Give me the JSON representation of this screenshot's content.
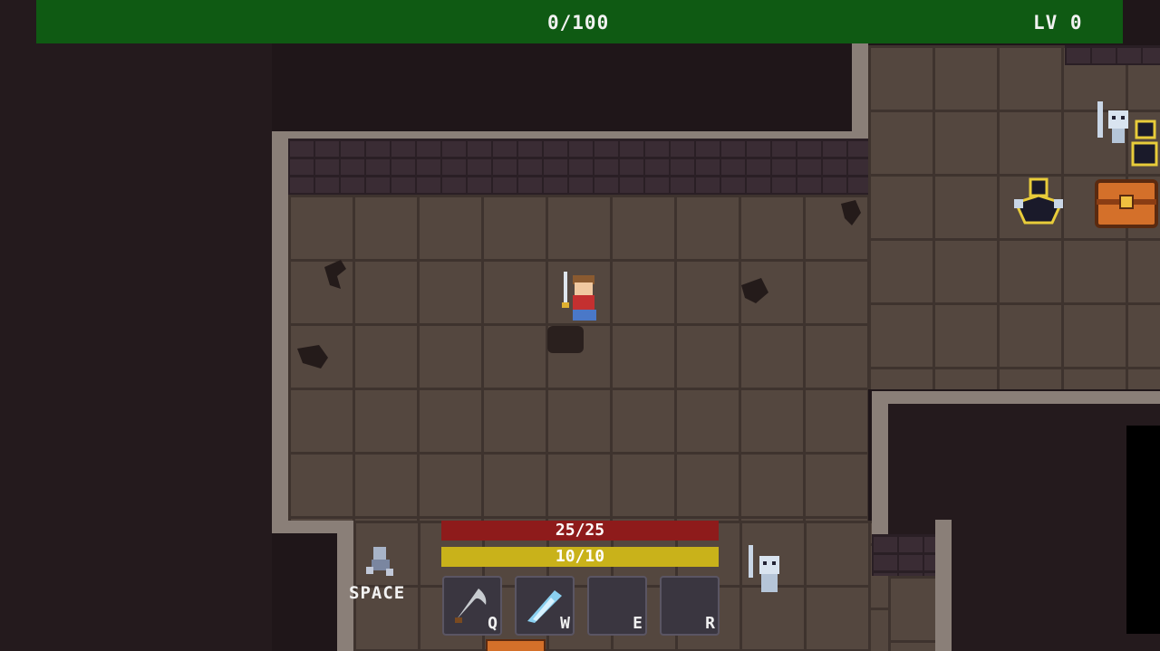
{
  "hud": {
    "xp_text": "0/100",
    "xp_fraction": 0,
    "level_text": "LV 0",
    "hp_text": "25/25",
    "hp_fraction": 1,
    "mp_text": "10/10",
    "mp_fraction": 1,
    "dash_label": "SPACE",
    "skills": [
      {
        "key": "Q",
        "icon": "scythe-icon",
        "empty": false
      },
      {
        "key": "W",
        "icon": "ice-bolt-icon",
        "empty": false
      },
      {
        "key": "E",
        "icon": "",
        "empty": true
      },
      {
        "key": "R",
        "icon": "",
        "empty": true
      }
    ]
  },
  "colors": {
    "xp_bar": "#1e7a22",
    "hp_bar": "#8e1b1b",
    "mp_bar": "#c9b21a",
    "floor": "#54473f",
    "wall": "#3a2c34"
  }
}
